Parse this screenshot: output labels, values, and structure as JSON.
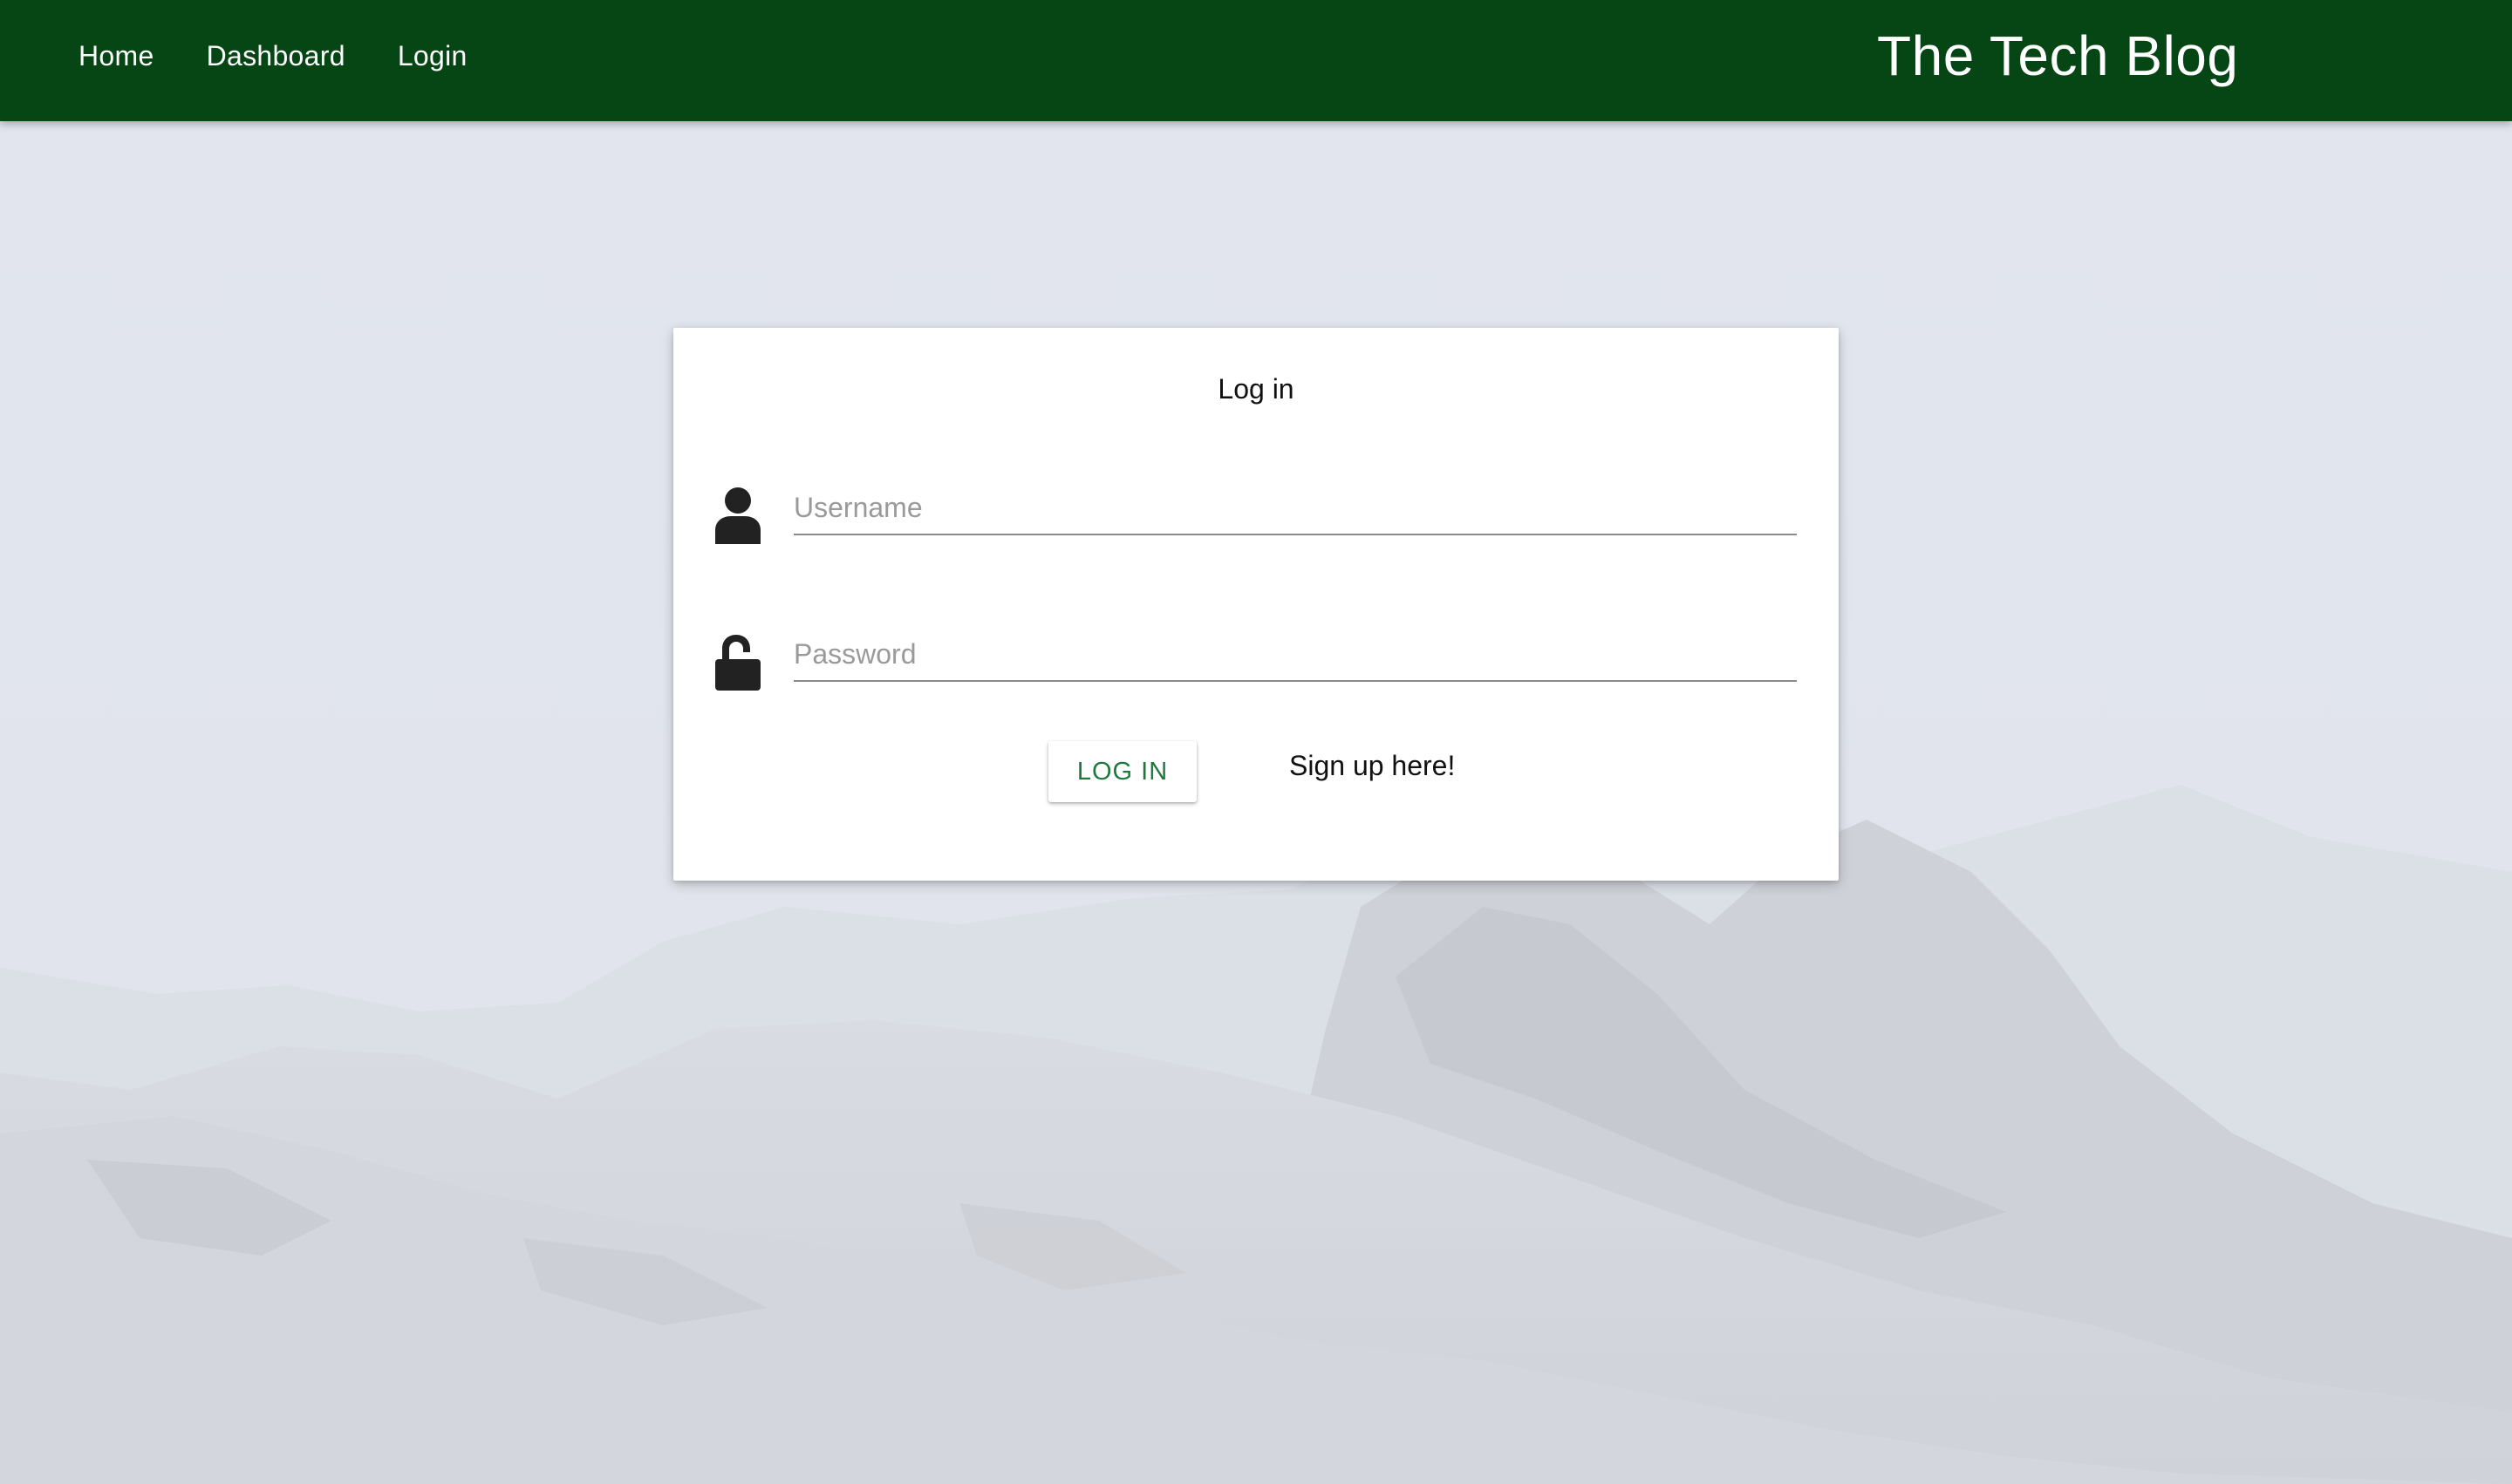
{
  "navbar": {
    "links": [
      {
        "label": "Home"
      },
      {
        "label": "Dashboard"
      },
      {
        "label": "Login"
      }
    ],
    "brand": "The Tech Blog",
    "color": "#054614"
  },
  "login_card": {
    "title": "Log in",
    "username": {
      "placeholder": "Username",
      "value": "",
      "icon": "user-icon"
    },
    "password": {
      "placeholder": "Password",
      "value": "",
      "icon": "unlock-icon"
    },
    "login_button_label": "LOG IN",
    "signup_link_label": "Sign up here!"
  },
  "colors": {
    "accent": "#1e7a3c",
    "background": "#e3e6ee"
  }
}
